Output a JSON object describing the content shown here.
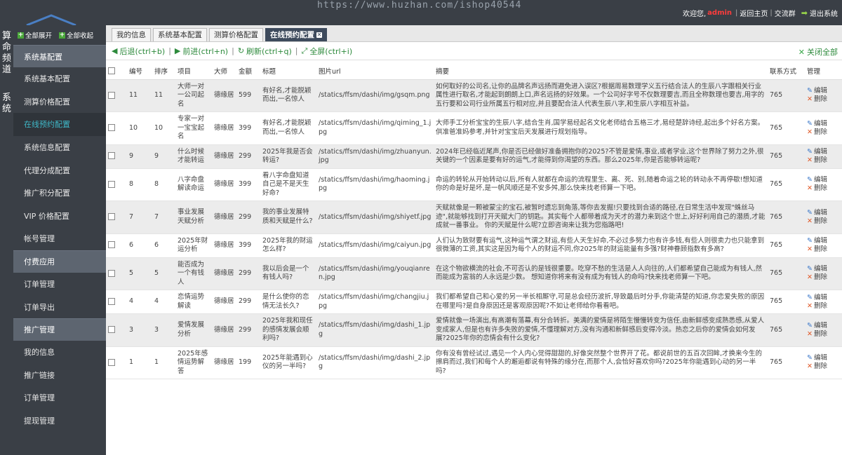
{
  "watermark": "https://www.huzhan.com/ishop40544",
  "header": {
    "welcome": "欢迎您,",
    "user": "admin",
    "links": [
      "返回主页",
      "交流群"
    ],
    "logout": "退出系统"
  },
  "rail": {
    "top": "算命频道",
    "bottom": "系统"
  },
  "sidebar": {
    "expand_all": "全部展开",
    "collapse_all": "全部收起",
    "groups": [
      {
        "label": "系统基配置",
        "items": [
          "系统基本配置",
          "测算价格配置",
          "在线预约配置",
          "系统信息配置",
          "代理分成配置",
          "推广积分配置",
          "VIP 价格配置",
          "帐号管理"
        ]
      },
      {
        "label": "付费应用",
        "items": [
          "订单管理",
          "订单导出"
        ]
      },
      {
        "label": "推广管理",
        "items": [
          "我的信息",
          "推广链接",
          "订单管理",
          "提现管理"
        ]
      }
    ],
    "active_item": "在线预约配置"
  },
  "tabs": [
    {
      "label": "我的信息",
      "active": false
    },
    {
      "label": "系统基本配置",
      "active": false
    },
    {
      "label": "测算价格配置",
      "active": false
    },
    {
      "label": "在线预约配置",
      "active": true
    }
  ],
  "toolbar": {
    "back": "后退(ctrl+b)",
    "forward": "前进(ctrl+n)",
    "refresh": "刷新(ctrl+q)",
    "fullscreen": "全屏(ctrl+i)",
    "close_all": "关闭全部"
  },
  "table": {
    "columns": [
      "编号",
      "排序",
      "项目",
      "大师",
      "金额",
      "标题",
      "图片url",
      "摘要",
      "联系方式",
      "管理"
    ],
    "edit_label": "编辑",
    "delete_label": "删除",
    "rows": [
      {
        "id": "11",
        "sort": "11",
        "project": "大师一对一公司起名",
        "master": "德缘居",
        "amount": "599",
        "title": "有好名,才能脱颖而出,一名惊人",
        "img": "/statics/ffsm/dashi/img/gsqm.png",
        "summary": "如何取好的公司名,让你的品牌名声远扬而避免进入误区?根据周易数理学义五行结合法人的生辰八字跟相关行业属性进行取名,才能起到朗朗上口,声名远扬的好效果。一个公司好字号不仅数理要吉,而且全称数理也要吉,用字的五行要和公司行业所属五行相对应,并且要配合法人代表生辰八字,和生辰八字相互补益。",
        "contact": "765"
      },
      {
        "id": "10",
        "sort": "10",
        "project": "专家一对一宝宝起名",
        "master": "德缘居",
        "amount": "399",
        "title": "有好名,才能脱颖而出,一名惊人",
        "img": "/statics/ffsm/dashi/img/qiming_1.jpg",
        "summary": "大师手工分析宝宝的生辰八字,结合生肖,国学易经起名文化老师结合五格三才,易经楚辞诗经,起出多个好名方案。供准爸准妈参考,并针对宝宝后天发展进行规划指导。",
        "contact": "765"
      },
      {
        "id": "9",
        "sort": "9",
        "project": "什么时候才能转运",
        "master": "德缘居",
        "amount": "299",
        "title": "2025年我是否会转运?",
        "img": "/statics/ffsm/dashi/img/zhuanyun.jpg",
        "summary": "2024年已经临近尾声,你是否已经做好准备拥抱你的2025?不管是爱情,事业,或者学业,这个世界除了努力之外,很关键的一个因素是要有好的运气,才能得到你渴望的东西。那么2025年,你是否能够转运呢?",
        "contact": "765"
      },
      {
        "id": "8",
        "sort": "8",
        "project": "八字命盘解读命运",
        "master": "德缘居",
        "amount": "399",
        "title": "看八字命盘知道自己是不是天生好命?",
        "img": "/statics/ffsm/dashi/img/haoming.jpg",
        "summary": "命运的转轮从开始转动以后,所有人就都在命运的流程里生、离、死、别,随着命运之轮的转动永不再停歇!想知道你的命是好是坏,是一帆风顺还是不安多舛,那么快来找老师算一下吧。",
        "contact": "765"
      },
      {
        "id": "7",
        "sort": "7",
        "project": "事业发展天赋分析",
        "master": "德缘居",
        "amount": "299",
        "title": "我的事业发展特质和天赋是什么?",
        "img": "/statics/ffsm/dashi/img/shiyetf.jpg",
        "summary": "天赋就像是一颗被蒙尘的宝石,被暂时遗忘到角落,等你去发掘!只要找到合适的路径,在日常生活中发现\"蛛丝马迹\",就能够找到打开天赋大门的钥匙。其实每个人都带着成为天才的潜力来到这个世上,好好利用自己的潜质,才能成就一番事业。 你的天赋是什么呢?立即咨询来让我为您指路吧!",
        "contact": "765"
      },
      {
        "id": "6",
        "sort": "6",
        "project": "2025年财运分析",
        "master": "德缘居",
        "amount": "399",
        "title": "2025年我的财运怎么样?",
        "img": "/statics/ffsm/dashi/img/caiyun.jpg",
        "summary": "人们认为致财要有运气,这种运气谓之财运,有些人天生好命,不必过多努力也有许多钱,有些人则很卖力也只能拿到很微薄的工资,其实这是因为每个人的财运不同,你2025年的财运能量有多强?财神眷顾指数有多高?",
        "contact": "765"
      },
      {
        "id": "5",
        "sort": "5",
        "project": "能否成为一个有钱人",
        "master": "德缘居",
        "amount": "299",
        "title": "我以后会是一个有钱人吗?",
        "img": "/statics/ffsm/dashi/img/youqianren.jpg",
        "summary": "在这个物欲横流的社会,不可否认的是钱很重要。吃穿不愁的生活是人人向往的,人们都希望自己能成为有钱人,然而能成为富翁的人永远是少数。 想知道你将来有没有成为有钱人的命吗?快来找老师算一下吧。",
        "contact": "765"
      },
      {
        "id": "4",
        "sort": "4",
        "project": "恋情运势解读",
        "master": "德缘居",
        "amount": "299",
        "title": "是什么使你的恋情无法长久?",
        "img": "/statics/ffsm/dashi/img/changjiu.jpg",
        "summary": "我们都希望自己和心爱的另一半长相厮守,可是总会经历波折,导致最后时分手,你能清楚的知道,你恋爱失败的原因在哪里吗?是自身原因还是客观原因呢?不如让老师给你看看吧。",
        "contact": "765"
      },
      {
        "id": "3",
        "sort": "3",
        "project": "爱情发展分析",
        "master": "德缘居",
        "amount": "299",
        "title": "2025年我和现任的感情发展会顺利吗?",
        "img": "/statics/ffsm/dashi/img/dashi_1.jpg",
        "summary": "爱情就像一场演出,有高潮有落幕,有分合转折。美满的爱情是将陌生慢慢转变为信任,由新鲜感变成熟悉感,从爱人变成家人,但是也有许多失败的爱情,不懂理解对方,没有沟通和新鲜感后变得冷淡。热恋之后你的爱情会如何发展?2025年你的恋情会有什么变化?",
        "contact": "765"
      },
      {
        "id": "1",
        "sort": "1",
        "project": "2025年感情运势解答",
        "master": "德缘居",
        "amount": "199",
        "title": "2025年能遇到心仪的另一半吗?",
        "img": "/statics/ffsm/dashi/img/dashi_2.jpg",
        "summary": "你有没有曾经试过,遇见一个人内心觉得甜甜的,好像突然整个世界开了花。都说前世的五百次回眸,才换来今生的擦肩而过,我们和每个人的邂逅都说有特殊的缘分在,而那个人,会恰好喜欢你吗?2025年你能遇到心动的另一半吗?",
        "contact": "765"
      }
    ]
  }
}
